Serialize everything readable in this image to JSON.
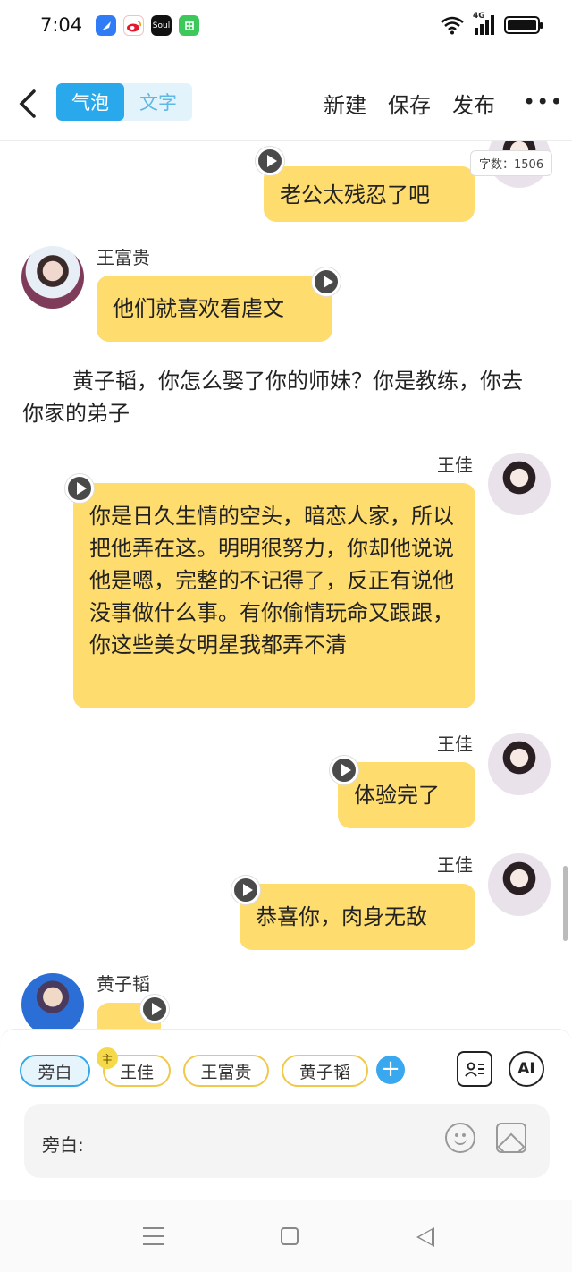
{
  "status_bar": {
    "time": "7:04",
    "apps": [
      "feather-app-icon",
      "weibo-icon",
      "soul-icon",
      "green-app-icon"
    ],
    "soul_label": "Soul",
    "network": "4G"
  },
  "header": {
    "modes": [
      "气泡",
      "文字"
    ],
    "active_mode": "气泡",
    "actions": [
      "新建",
      "保存",
      "发布"
    ],
    "more": "•••"
  },
  "word_count": "字数：1506",
  "messages": [
    {
      "speaker": "",
      "side": "right",
      "text": "老公太残忍了吧"
    },
    {
      "speaker": "王富贵",
      "side": "left",
      "text": "他们就喜欢看虐文"
    },
    {
      "speaker": "",
      "side": "narration",
      "text": "黄子韬，你怎么娶了你的师妹？你是教练，你去你家的弟子"
    },
    {
      "speaker": "王佳",
      "side": "right",
      "text": "你是日久生情的空头，暗恋人家，所以把他弄在这。明明很努力，你却他说说他是嗯，完整的不记得了，反正有说他没事做什么事。有你偷情玩命又跟跟，你这些美女明星我都弄不清"
    },
    {
      "speaker": "王佳",
      "side": "right",
      "text": "体验完了"
    },
    {
      "speaker": "王佳",
      "side": "right",
      "text": "恭喜你，肉身无敌"
    },
    {
      "speaker": "黄子韬",
      "side": "left",
      "text": ""
    }
  ],
  "roles": {
    "chips": [
      "旁白",
      "王佳",
      "王富贵",
      "黄子韬"
    ],
    "selected": "旁白",
    "main_badge": "主",
    "add": "+"
  },
  "tools": {
    "ai_label": "AI"
  },
  "input": {
    "label": "旁白:"
  },
  "accent_colors": {
    "bubble": "#ffdc6e",
    "primary": "#2aa8ec"
  }
}
